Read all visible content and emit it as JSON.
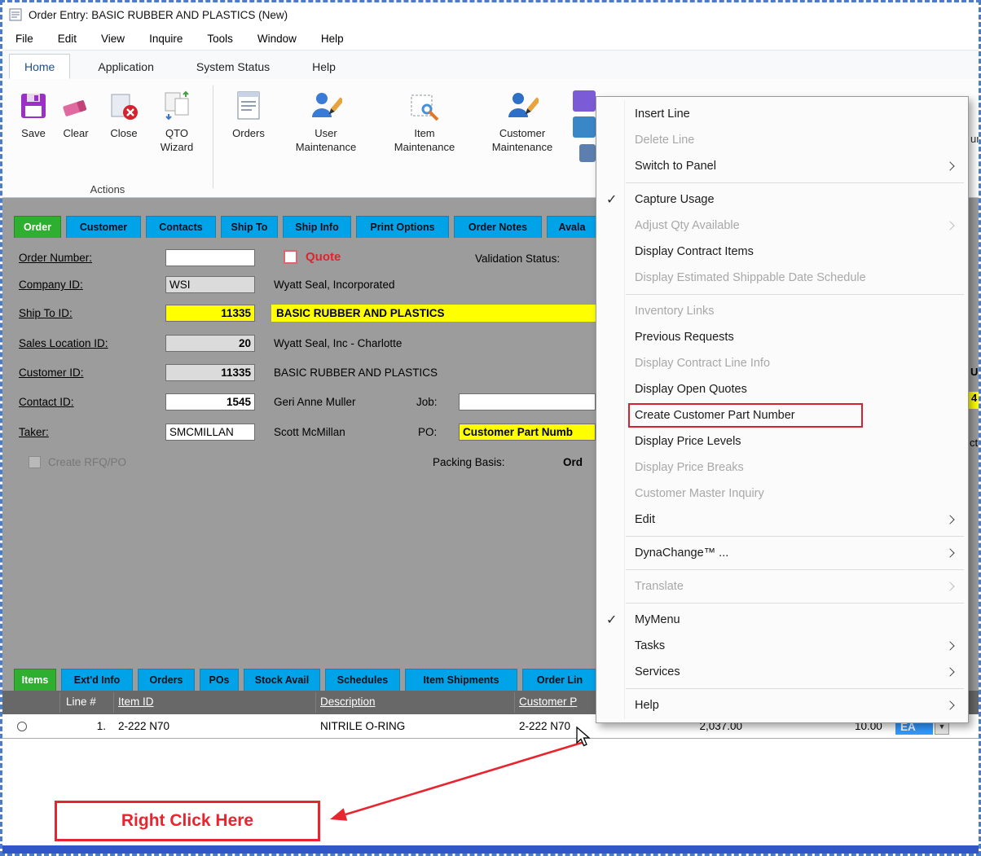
{
  "colors": {
    "tab_blue": "#00A2E8",
    "tab_active_green": "#2FAF2F",
    "field_yellow": "#FFFF00",
    "menu_highlight_red": "#D8232E",
    "annotation_red": "#E8252F",
    "selection_blue": "#3399FE",
    "bottom_bar_blue": "#3056C8"
  },
  "window": {
    "title": "Order Entry: BASIC RUBBER AND PLASTICS (New)"
  },
  "menubar": [
    "File",
    "Edit",
    "View",
    "Inquire",
    "Tools",
    "Window",
    "Help"
  ],
  "ribbon": {
    "tabs": [
      "Home",
      "Application",
      "System Status",
      "Help"
    ],
    "active_tab": "Home",
    "buttons": [
      "Save",
      "Clear",
      "Close",
      "QTO Wizard",
      "Orders",
      "User Maintenance",
      "Item Maintenance",
      "Customer Maintenance"
    ],
    "group_label": "Actions",
    "edge_fragment": "un"
  },
  "order_form": {
    "tabs": [
      "Order",
      "Customer",
      "Contacts",
      "Ship To",
      "Ship Info",
      "Print Options",
      "Order Notes",
      "Avala"
    ],
    "active_tab": "Order",
    "quote_label": "Quote",
    "validation_status_label": "Validation Status:",
    "fields": {
      "order_number_label": "Order Number:",
      "order_number_value": "",
      "company_label": "Company ID:",
      "company_value": "WSI",
      "company_desc": "Wyatt Seal, Incorporated",
      "ship_to_label": "Ship To ID:",
      "ship_to_value": "11335",
      "ship_to_desc": "BASIC RUBBER AND PLASTICS",
      "sales_location_label": "Sales Location ID:",
      "sales_location_value": "20",
      "sales_location_desc": "Wyatt Seal, Inc - Charlotte",
      "customer_label": "Customer ID:",
      "customer_value": "11335",
      "customer_desc": "BASIC RUBBER AND PLASTICS",
      "contact_label": "Contact ID:",
      "contact_value": "1545",
      "contact_desc": "Geri Anne Muller",
      "job_label": "Job:",
      "job_value": "",
      "taker_label": "Taker:",
      "taker_value": "SMCMILLAN",
      "taker_desc": "Scott McMillan",
      "po_label": "PO:",
      "po_value": "Customer Part Numb",
      "create_rfq_label": "Create RFQ/PO",
      "packing_basis_label": "Packing Basis:",
      "packing_basis_value": "Ord"
    },
    "edge_fragments": {
      "top": "U",
      "yellow": "4",
      "bottom": "ct"
    }
  },
  "items_panel": {
    "tabs": [
      "Items",
      "Ext'd Info",
      "Orders",
      "POs",
      "Stock Avail",
      "Schedules",
      "Item Shipments",
      "Order Lin"
    ],
    "active_tab": "Items",
    "columns": [
      "Line #",
      "Item ID",
      "Description",
      "Customer P"
    ],
    "row": {
      "line": "1.",
      "item_id": "2-222 N70",
      "description": "NITRILE O-RING",
      "customer_part": "2-222 N70",
      "amount_fragment": "2,037.00",
      "qty_fragment": "10.00",
      "uom": "EA"
    }
  },
  "context_menu": {
    "items": [
      {
        "label": "Insert Line",
        "enabled": true
      },
      {
        "label": "Delete Line",
        "enabled": false
      },
      {
        "label": "Switch to Panel",
        "enabled": true,
        "submenu": true
      },
      {
        "label": "Capture Usage",
        "enabled": true,
        "checked": true
      },
      {
        "label": "Adjust Qty Available",
        "enabled": false,
        "submenu": true
      },
      {
        "label": "Display Contract Items",
        "enabled": true
      },
      {
        "label": "Display Estimated Shippable Date Schedule",
        "enabled": false
      },
      {
        "label": "Inventory Links",
        "enabled": false
      },
      {
        "label": "Previous Requests",
        "enabled": true
      },
      {
        "label": "Display Contract Line Info",
        "enabled": false
      },
      {
        "label": "Display Open Quotes",
        "enabled": true
      },
      {
        "label": "Create Customer Part Number",
        "enabled": true,
        "highlighted": true
      },
      {
        "label": "Display Price Levels",
        "enabled": true
      },
      {
        "label": "Display Price Breaks",
        "enabled": false
      },
      {
        "label": "Customer Master Inquiry",
        "enabled": false
      },
      {
        "label": "Edit",
        "enabled": true,
        "submenu": true
      },
      {
        "label": "DynaChange™ ...",
        "enabled": true,
        "submenu": true
      },
      {
        "label": "Translate",
        "enabled": false,
        "submenu": true
      },
      {
        "label": "MyMenu",
        "enabled": true,
        "checked": true
      },
      {
        "label": "Tasks",
        "enabled": true,
        "submenu": true
      },
      {
        "label": "Services",
        "enabled": true,
        "submenu": true
      },
      {
        "label": "Help",
        "enabled": true,
        "submenu": true
      }
    ]
  },
  "annotation": {
    "label": "Right Click Here"
  }
}
